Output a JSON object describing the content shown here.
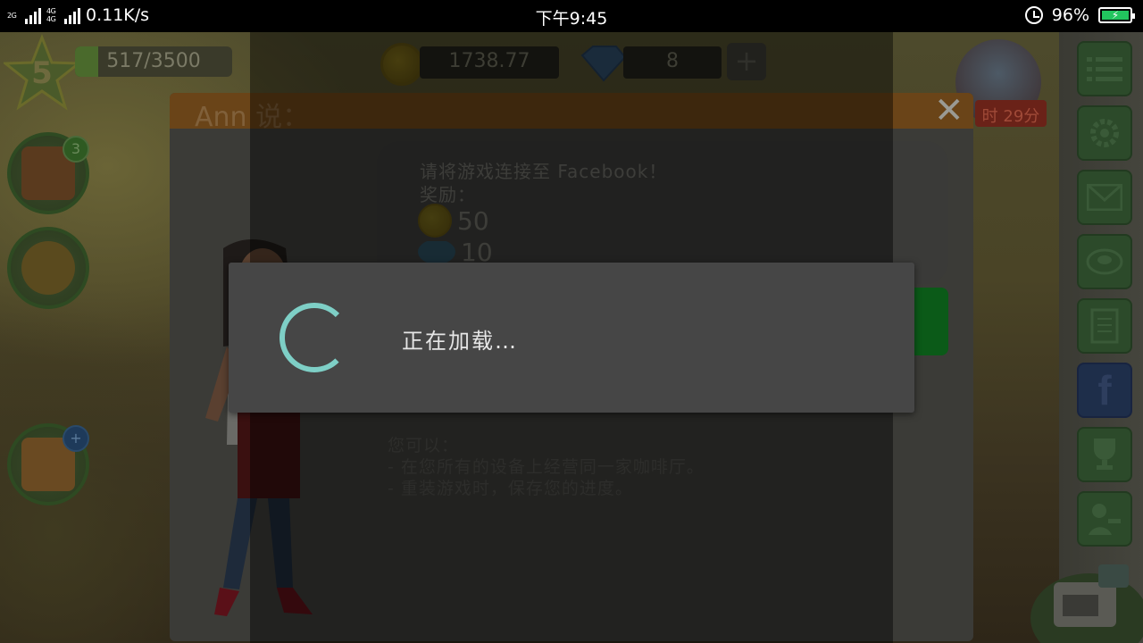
{
  "status_bar": {
    "network_tags": [
      "2G",
      "4G 4G",
      "2G"
    ],
    "speed": "0.11K/s",
    "time": "下午9:45",
    "battery_percent": "96%",
    "battery_level": 0.96
  },
  "hud": {
    "level": "5",
    "xp": "517/3500",
    "xp_fraction": 0.148,
    "coins": "1738.77",
    "gems": "8",
    "plus_label": "+",
    "event_timer": "时 29分"
  },
  "left_buttons": {
    "recipe_book_badge": "3",
    "gift_badge": "+"
  },
  "dialog": {
    "title": "Ann 说：",
    "close_label": "✕",
    "prompt": "请将游戏连接至 Facebook！",
    "reward_label": "奖励：",
    "reward_coins": "50",
    "reward_gems": "10",
    "benefits_heading": "您可以：",
    "benefit_1": "- 在您所有的设备上经营同一家咖啡厅。",
    "benefit_2": "- 重装游戏时，保存您的进度。"
  },
  "loading": {
    "text": "正在加载…"
  },
  "colors": {
    "spinner": "#7ecfc6",
    "battery": "#22c55e",
    "dialog_header": "#6a4418"
  },
  "icons": {
    "rail": [
      "menu-icon",
      "gear-icon",
      "mail-icon",
      "recipes-icon",
      "notepad-icon",
      "facebook-icon",
      "trophy-icon",
      "staff-icon"
    ]
  }
}
